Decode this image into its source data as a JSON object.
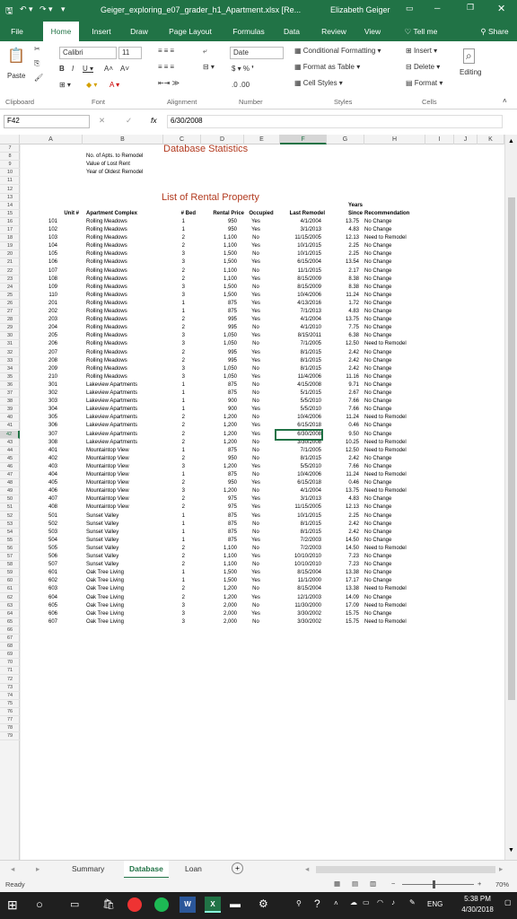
{
  "titlebar": {
    "title": "Geiger_exploring_e07_grader_h1_Apartment.xlsx [Re...",
    "user": "Elizabeth Geiger"
  },
  "tabs": [
    "File",
    "Home",
    "Insert",
    "Draw",
    "Page Layout",
    "Formulas",
    "Data",
    "Review",
    "View",
    "Tell me",
    "Share"
  ],
  "ribbon": {
    "paste": "Paste",
    "font_name": "Calibri",
    "font_size": "11",
    "number_format": "Date",
    "cond_format": "Conditional Formatting",
    "format_table": "Format as Table",
    "cell_styles": "Cell Styles",
    "insert": "Insert",
    "delete": "Delete",
    "format": "Format",
    "editing": "Editing",
    "groups": [
      "Clipboard",
      "Font",
      "Alignment",
      "Number",
      "Styles",
      "Cells"
    ]
  },
  "formula": {
    "namebox": "F42",
    "fx": "fx",
    "value": "6/30/2008"
  },
  "columns": [
    "A",
    "B",
    "C",
    "D",
    "E",
    "F",
    "G",
    "H",
    "I",
    "J",
    "K"
  ],
  "sheet": {
    "stats_title": "Database Statistics",
    "stats_labels": [
      "No. of Apts. to Remodel",
      "Value of Lost Rent",
      "Year of Oldest Remodel"
    ],
    "list_title": "List of Rental Property",
    "headers": {
      "unit": "Unit #",
      "complex": "Apartment Complex",
      "bed": "# Bed",
      "rent": "Rental Price",
      "occupied": "Occupied",
      "remodel": "Last Remodel",
      "years_top": "Years",
      "years_bottom": "Since",
      "rec": "Recommendation"
    },
    "rows": [
      [
        "101",
        "Rolling Meadows",
        "1",
        "950",
        "Yes",
        "4/1/2004",
        "13.75",
        "No Change"
      ],
      [
        "102",
        "Rolling Meadows",
        "1",
        "950",
        "Yes",
        "3/1/2013",
        "4.83",
        "No Change"
      ],
      [
        "103",
        "Rolling Meadows",
        "2",
        "1,100",
        "No",
        "11/15/2005",
        "12.13",
        "Need to Remodel"
      ],
      [
        "104",
        "Rolling Meadows",
        "2",
        "1,100",
        "Yes",
        "10/1/2015",
        "2.25",
        "No Change"
      ],
      [
        "105",
        "Rolling Meadows",
        "3",
        "1,500",
        "No",
        "10/1/2015",
        "2.25",
        "No Change"
      ],
      [
        "106",
        "Rolling Meadows",
        "3",
        "1,500",
        "Yes",
        "6/15/2004",
        "13.54",
        "No Change"
      ],
      [
        "107",
        "Rolling Meadows",
        "2",
        "1,100",
        "No",
        "11/1/2015",
        "2.17",
        "No Change"
      ],
      [
        "108",
        "Rolling Meadows",
        "2",
        "1,100",
        "Yes",
        "8/15/2009",
        "8.38",
        "No Change"
      ],
      [
        "109",
        "Rolling Meadows",
        "3",
        "1,500",
        "No",
        "8/15/2009",
        "8.38",
        "No Change"
      ],
      [
        "110",
        "Rolling Meadows",
        "3",
        "1,500",
        "Yes",
        "10/4/2006",
        "11.24",
        "No Change"
      ],
      [
        "201",
        "Rolling Meadows",
        "1",
        "875",
        "Yes",
        "4/13/2016",
        "1.72",
        "No Change"
      ],
      [
        "202",
        "Rolling Meadows",
        "1",
        "875",
        "Yes",
        "7/1/2013",
        "4.83",
        "No Change"
      ],
      [
        "203",
        "Rolling Meadows",
        "2",
        "995",
        "Yes",
        "4/1/2004",
        "13.75",
        "No Change"
      ],
      [
        "204",
        "Rolling Meadows",
        "2",
        "995",
        "No",
        "4/1/2010",
        "7.75",
        "No Change"
      ],
      [
        "205",
        "Rolling Meadows",
        "3",
        "1,050",
        "Yes",
        "8/15/2011",
        "6.38",
        "No Change"
      ],
      [
        "206",
        "Rolling Meadows",
        "3",
        "1,050",
        "No",
        "7/1/2005",
        "12.50",
        "Need to Remodel"
      ],
      [
        "207",
        "Rolling Meadows",
        "2",
        "995",
        "Yes",
        "8/1/2015",
        "2.42",
        "No Change"
      ],
      [
        "208",
        "Rolling Meadows",
        "2",
        "995",
        "Yes",
        "8/1/2015",
        "2.42",
        "No Change"
      ],
      [
        "209",
        "Rolling Meadows",
        "3",
        "1,050",
        "No",
        "8/1/2015",
        "2.42",
        "No Change"
      ],
      [
        "210",
        "Rolling Meadows",
        "3",
        "1,050",
        "Yes",
        "11/4/2006",
        "11.16",
        "No Change"
      ],
      [
        "301",
        "Lakeview Apartments",
        "1",
        "875",
        "No",
        "4/15/2008",
        "9.71",
        "No Change"
      ],
      [
        "302",
        "Lakeview Apartments",
        "1",
        "875",
        "No",
        "5/1/2015",
        "2.67",
        "No Change"
      ],
      [
        "303",
        "Lakeview Apartments",
        "1",
        "900",
        "No",
        "5/5/2010",
        "7.66",
        "No Change"
      ],
      [
        "304",
        "Lakeview Apartments",
        "1",
        "900",
        "Yes",
        "5/5/2010",
        "7.66",
        "No Change"
      ],
      [
        "305",
        "Lakeview Apartments",
        "2",
        "1,200",
        "No",
        "10/4/2006",
        "11.24",
        "Need to Remodel"
      ],
      [
        "306",
        "Lakeview Apartments",
        "2",
        "1,200",
        "Yes",
        "6/15/2018",
        "0.46",
        "No Change"
      ],
      [
        "307",
        "Lakeview Apartments",
        "2",
        "1,200",
        "Yes",
        "6/30/2008",
        "9.50",
        "No Change"
      ],
      [
        "308",
        "Lakeview Apartments",
        "2",
        "1,200",
        "No",
        "3/30/2008",
        "10.25",
        "Need to Remodel"
      ],
      [
        "401",
        "Mountaintop View",
        "1",
        "875",
        "No",
        "7/1/2005",
        "12.50",
        "Need to Remodel"
      ],
      [
        "402",
        "Mountaintop View",
        "2",
        "950",
        "No",
        "8/1/2015",
        "2.42",
        "No Change"
      ],
      [
        "403",
        "Mountaintop View",
        "3",
        "1,200",
        "Yes",
        "5/5/2010",
        "7.66",
        "No Change"
      ],
      [
        "404",
        "Mountaintop View",
        "1",
        "875",
        "No",
        "10/4/2006",
        "11.24",
        "Need to Remodel"
      ],
      [
        "405",
        "Mountaintop View",
        "2",
        "950",
        "Yes",
        "6/15/2018",
        "0.46",
        "No Change"
      ],
      [
        "406",
        "Mountaintop View",
        "3",
        "1,200",
        "No",
        "4/1/2004",
        "13.75",
        "Need to Remodel"
      ],
      [
        "407",
        "Mountaintop View",
        "2",
        "975",
        "Yes",
        "3/1/2013",
        "4.83",
        "No Change"
      ],
      [
        "408",
        "Mountaintop View",
        "2",
        "975",
        "Yes",
        "11/15/2005",
        "12.13",
        "No Change"
      ],
      [
        "501",
        "Sunset Valley",
        "1",
        "875",
        "Yes",
        "10/1/2015",
        "2.25",
        "No Change"
      ],
      [
        "502",
        "Sunset Valley",
        "1",
        "875",
        "No",
        "8/1/2015",
        "2.42",
        "No Change"
      ],
      [
        "503",
        "Sunset Valley",
        "1",
        "875",
        "No",
        "8/1/2015",
        "2.42",
        "No Change"
      ],
      [
        "504",
        "Sunset Valley",
        "1",
        "875",
        "Yes",
        "7/2/2003",
        "14.50",
        "No Change"
      ],
      [
        "505",
        "Sunset Valley",
        "2",
        "1,100",
        "No",
        "7/2/2003",
        "14.50",
        "Need to Remodel"
      ],
      [
        "506",
        "Sunset Valley",
        "2",
        "1,100",
        "Yes",
        "10/10/2010",
        "7.23",
        "No Change"
      ],
      [
        "507",
        "Sunset Valley",
        "2",
        "1,100",
        "No",
        "10/10/2010",
        "7.23",
        "No Change"
      ],
      [
        "601",
        "Oak Tree Living",
        "1",
        "1,500",
        "Yes",
        "8/15/2004",
        "13.38",
        "No Change"
      ],
      [
        "602",
        "Oak Tree Living",
        "1",
        "1,500",
        "Yes",
        "11/1/2000",
        "17.17",
        "No Change"
      ],
      [
        "603",
        "Oak Tree Living",
        "2",
        "1,200",
        "No",
        "8/15/2004",
        "13.38",
        "Need to Remodel"
      ],
      [
        "604",
        "Oak Tree Living",
        "2",
        "1,200",
        "Yes",
        "12/1/2003",
        "14.09",
        "No Change"
      ],
      [
        "605",
        "Oak Tree Living",
        "3",
        "2,000",
        "No",
        "11/30/2000",
        "17.09",
        "Need to Remodel"
      ],
      [
        "606",
        "Oak Tree Living",
        "3",
        "2,000",
        "Yes",
        "3/30/2002",
        "15.75",
        "No Change"
      ],
      [
        "607",
        "Oak Tree Living",
        "3",
        "2,000",
        "No",
        "3/30/2002",
        "15.75",
        "Need to Remodel"
      ]
    ]
  },
  "row_numbers": [
    "7",
    "8",
    "9",
    "10",
    "11",
    "12",
    "13",
    "14",
    "15",
    "16",
    "17",
    "18",
    "19",
    "20",
    "21",
    "22",
    "23",
    "24",
    "25",
    "26",
    "27",
    "28",
    "29",
    "30",
    "31",
    "32",
    "33",
    "34",
    "35",
    "36",
    "37",
    "38",
    "39",
    "40",
    "41",
    "42",
    "43",
    "44",
    "45",
    "46",
    "47",
    "48",
    "49",
    "50",
    "51",
    "52",
    "53",
    "54",
    "55",
    "56",
    "57",
    "58",
    "59",
    "60",
    "61",
    "62",
    "63",
    "64",
    "65",
    "66",
    "67",
    "68",
    "69",
    "70",
    "71",
    "72",
    "73",
    "74",
    "75",
    "76",
    "77",
    "78",
    "79"
  ],
  "sheet_tabs": [
    "Summary",
    "Database",
    "Loan"
  ],
  "status": {
    "ready": "Ready",
    "zoom": "70%"
  },
  "taskbar": {
    "lang": "ENG",
    "time": "5:38 PM",
    "date": "4/30/2018"
  }
}
